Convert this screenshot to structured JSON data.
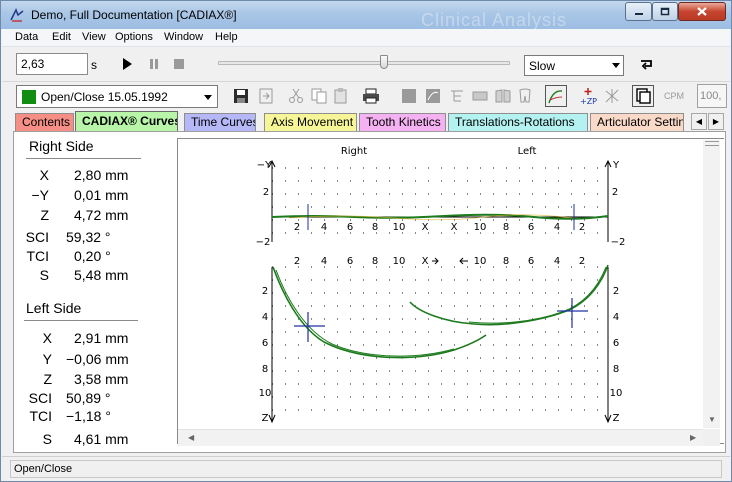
{
  "window": {
    "title": "Demo, Full Documentation [CADIAX®]",
    "ghost_title": "Clinical Analysis"
  },
  "menu": [
    "Data",
    "Edit",
    "View",
    "Options",
    "Window",
    "Help"
  ],
  "playback": {
    "time_value": "2,63",
    "time_unit": "s",
    "slider_position": 0.57,
    "speed": "Slow"
  },
  "toolbar": {
    "record_label": "Open/Close 15.05.1992",
    "record_color": "#118d11",
    "cpm_label": "CPM",
    "zoom_value": "100,"
  },
  "tabs": [
    {
      "label": "Contents",
      "color": "#f58f86"
    },
    {
      "label": "CADIAX® Curves",
      "color": "#b8f5a8",
      "active": true
    },
    {
      "label": "Time Curves",
      "color": "#b5b7f7"
    },
    {
      "label": "Axis Movement",
      "color": "#f6f699"
    },
    {
      "label": "Tooth Kinetics",
      "color": "#f4b2f2"
    },
    {
      "label": "Translations-Rotations",
      "color": "#b3f2f0"
    },
    {
      "label": "Articulator Settin",
      "color": "#f9d9c8"
    }
  ],
  "right_side": {
    "heading": "Right Side",
    "rows": [
      {
        "label": "X",
        "value": "2,80 mm"
      },
      {
        "label": "−Y",
        "value": "0,01 mm"
      },
      {
        "label": "Z",
        "value": "4,72 mm"
      },
      {
        "label": "SCI",
        "value": "59,32  °"
      },
      {
        "label": "TCI",
        "value": "0,20  °"
      },
      {
        "label": "S",
        "value": "5,48 mm"
      }
    ]
  },
  "left_side": {
    "heading": "Left Side",
    "rows": [
      {
        "label": "X",
        "value": "2,91 mm"
      },
      {
        "label": "Y",
        "value": "−0,06 mm"
      },
      {
        "label": "Z",
        "value": "3,58 mm"
      },
      {
        "label": "SCI",
        "value": "50,89 °"
      },
      {
        "label": "TCI",
        "value": "−1,18 °"
      },
      {
        "label": "S",
        "value": "4,61 mm"
      }
    ]
  },
  "plot": {
    "right_title": "Right",
    "left_title": "Left",
    "top_axis_labels": {
      "neg_y_right": "−Y",
      "y_left": "Y",
      "two_top_r": "2",
      "two_top_l": "2",
      "neg_two_r": "−2",
      "neg_two_l": "−2"
    },
    "top_x_ticks_right": [
      "2",
      "4",
      "6",
      "8",
      "10",
      "X"
    ],
    "top_x_ticks_left": [
      "X",
      "10",
      "8",
      "6",
      "4",
      "2"
    ],
    "mid_x_ticks_right": [
      "2",
      "4",
      "6",
      "8",
      "10",
      "X"
    ],
    "mid_x_ticks_left": [
      "10",
      "8",
      "6",
      "4",
      "2"
    ],
    "z_ticks": [
      "2",
      "4",
      "6",
      "8",
      "10",
      "Z"
    ],
    "curve_color": "#1d7a1d"
  },
  "status": {
    "text": "Open/Close"
  }
}
